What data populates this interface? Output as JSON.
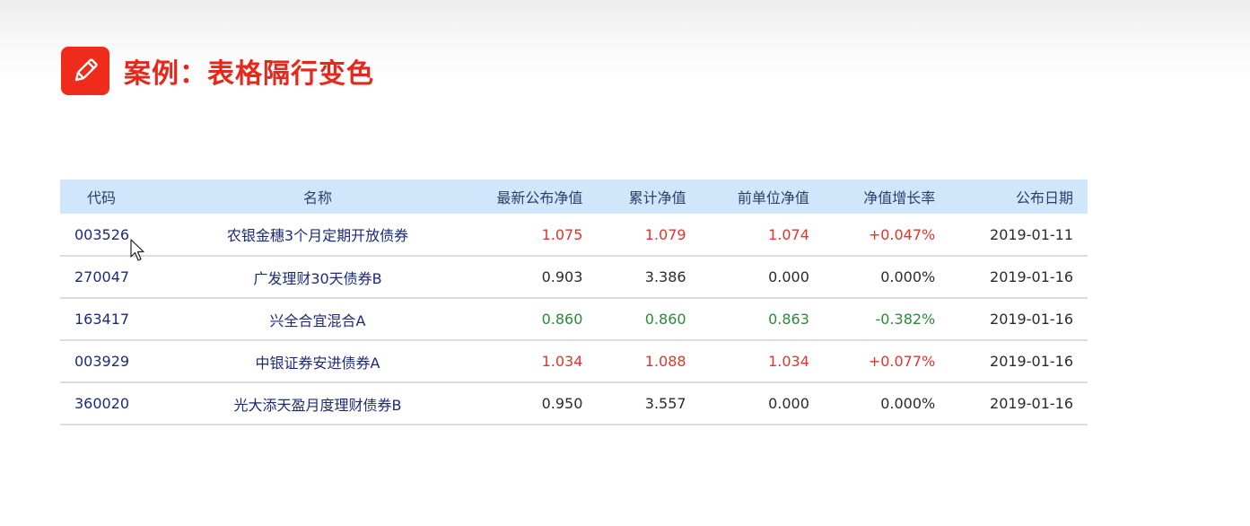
{
  "header": {
    "icon": "pencil-icon",
    "title": "案例：表格隔行变色",
    "accent_color": "#e8271a"
  },
  "table": {
    "columns": [
      "代码",
      "名称",
      "最新公布净值",
      "累计净值",
      "前单位净值",
      "净值增长率",
      "公布日期"
    ],
    "rows": [
      {
        "code": "003526",
        "name": "农银金穗3个月定期开放债券",
        "nav": "1.075",
        "acc_nav": "1.079",
        "prev_nav": "1.074",
        "rate": "+0.047%",
        "date": "2019-01-11",
        "trend": "up"
      },
      {
        "code": "270047",
        "name": "广发理财30天债券B",
        "nav": "0.903",
        "acc_nav": "3.386",
        "prev_nav": "0.000",
        "rate": "0.000%",
        "date": "2019-01-16",
        "trend": "flat"
      },
      {
        "code": "163417",
        "name": "兴全合宜混合A",
        "nav": "0.860",
        "acc_nav": "0.860",
        "prev_nav": "0.863",
        "rate": "-0.382%",
        "date": "2019-01-16",
        "trend": "down"
      },
      {
        "code": "003929",
        "name": "中银证券安进债券A",
        "nav": "1.034",
        "acc_nav": "1.088",
        "prev_nav": "1.034",
        "rate": "+0.077%",
        "date": "2019-01-16",
        "trend": "up"
      },
      {
        "code": "360020",
        "name": "光大添天盈月度理财债券B",
        "nav": "0.950",
        "acc_nav": "3.557",
        "prev_nav": "0.000",
        "rate": "0.000%",
        "date": "2019-01-16",
        "trend": "flat"
      }
    ],
    "header_color": "#cfe6fb",
    "up_color": "#e0352b",
    "down_color": "#2d8a36"
  }
}
